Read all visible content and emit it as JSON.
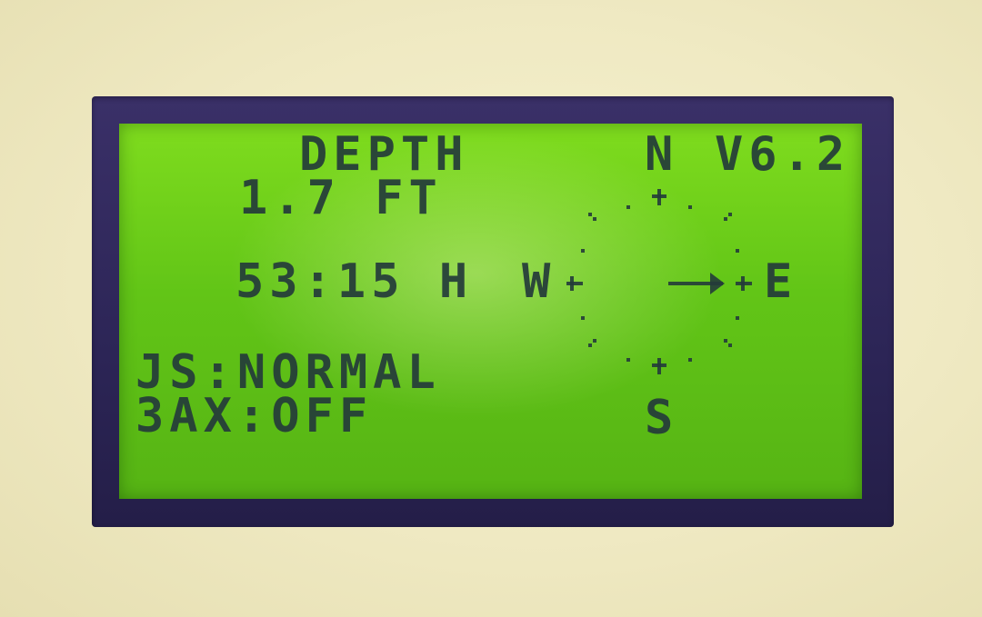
{
  "lcd": {
    "title": "DEPTH",
    "depth_value": "1.7",
    "depth_unit": "FT",
    "time_display": "53:15 H",
    "js_mode": "JS:NORMAL",
    "three_axis": "3AX:OFF"
  },
  "compass": {
    "north": "N",
    "south": "S",
    "west": "W",
    "east": "E"
  },
  "firmware_version": "V6.2",
  "colors": {
    "lcd_background": "#62c517",
    "lcd_text": "#243b3a",
    "bezel": "#2c2556",
    "device_body": "#efe9c2"
  }
}
